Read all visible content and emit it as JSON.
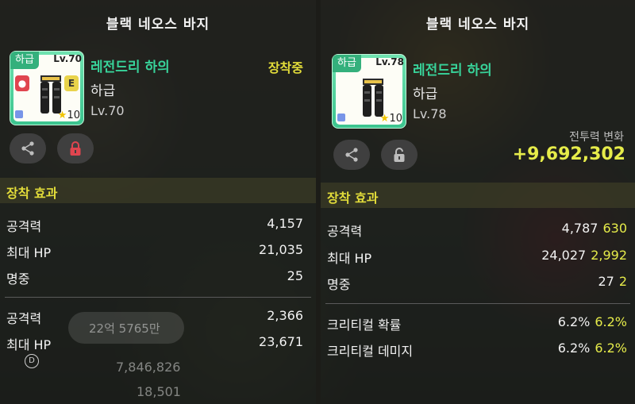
{
  "left": {
    "title": "블랙 네오스 바지",
    "item": {
      "grade_tab": "하급",
      "level_tab": "Lv.70",
      "star_count": "10",
      "lock_icon": "lock-icon",
      "e_badge": "E"
    },
    "name": "레전드리 하의",
    "grade": "하급",
    "level": "Lv.70",
    "equipped": "장착중",
    "buttons": [
      "share-icon",
      "lock-icon"
    ],
    "section_title": "장착 효과",
    "stats": [
      {
        "label": "공격력",
        "value": "4,157"
      },
      {
        "label": "최대 HP",
        "value": "21,035"
      },
      {
        "label": "명중",
        "value": "25"
      }
    ],
    "stats2": [
      {
        "label": "공격력",
        "value": "2,366"
      },
      {
        "label": "최대 HP",
        "value": "23,671"
      }
    ],
    "ghost_text": {
      "pill": "22억 5765만",
      "badge": "D",
      "line1": "7,846,826",
      "line2": "18,501"
    }
  },
  "right": {
    "title": "블랙 네오스 바지",
    "item": {
      "grade_tab": "하급",
      "level_tab": "Lv.78",
      "star_count": "10"
    },
    "name": "레전드리 하의",
    "grade": "하급",
    "level": "Lv.78",
    "buttons": [
      "share-icon",
      "unlock-icon"
    ],
    "power_label": "전투력 변화",
    "power_value": "+9,692,302",
    "section_title": "장착 효과",
    "stats": [
      {
        "label": "공격력",
        "value": "4,787",
        "diff": "630"
      },
      {
        "label": "최대 HP",
        "value": "24,027",
        "diff": "2,992"
      },
      {
        "label": "명중",
        "value": "27",
        "diff": "2"
      }
    ],
    "stats2": [
      {
        "label": "크리티컬 확률",
        "value": "6.2%",
        "diff": "6.2%"
      },
      {
        "label": "크리티컬 데미지",
        "value": "6.2%",
        "diff": "6.2%"
      }
    ]
  },
  "colors": {
    "accent_green": "#38d39a",
    "accent_yellow": "#e6ec4a",
    "lock_red": "#e0454f"
  }
}
